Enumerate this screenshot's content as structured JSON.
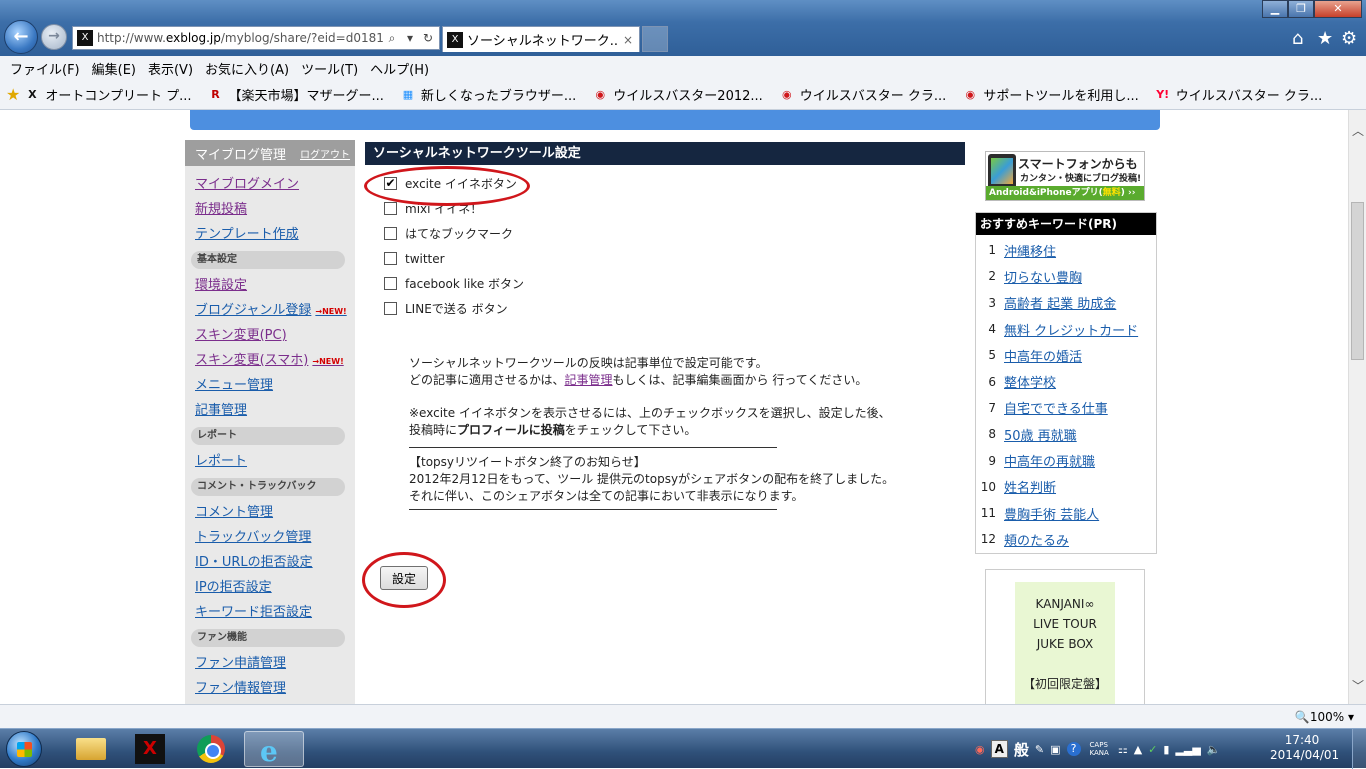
{
  "browser": {
    "address_prefix": "http://www.",
    "address_domain": "exblog.jp",
    "address_rest": "/myblog/share/?eid=d0181",
    "tab_title": "ソーシャルネットワーク...",
    "close_glyph": "×"
  },
  "menu": [
    "ファイル(F)",
    "編集(E)",
    "表示(V)",
    "お気に入り(A)",
    "ツール(T)",
    "ヘルプ(H)"
  ],
  "favorites": [
    {
      "label": "オートコンプリート プ...",
      "icon": "excite-icon",
      "glyph": "X",
      "color": "#111111"
    },
    {
      "label": "【楽天市場】マザーグー...",
      "icon": "rakuten-icon",
      "glyph": "R",
      "color": "#bf0000"
    },
    {
      "label": "新しくなったブラウザー...",
      "icon": "windows-icon",
      "glyph": "▦",
      "color": "#1e90ff"
    },
    {
      "label": "ウイルスバスター2012...",
      "icon": "trendmicro-icon",
      "glyph": "◉",
      "color": "#d0161b"
    },
    {
      "label": "ウイルスバスター クラ...",
      "icon": "trendmicro-icon",
      "glyph": "◉",
      "color": "#d0161b"
    },
    {
      "label": "サポートツールを利用し...",
      "icon": "trendmicro-icon",
      "glyph": "◉",
      "color": "#d0161b"
    },
    {
      "label": "ウイルスバスター クラ...",
      "icon": "yahoo-icon",
      "glyph": "Y!",
      "color": "#ff0033"
    }
  ],
  "leftnav": {
    "header": "マイブログ管理",
    "logout": "ログアウト",
    "group1": [
      {
        "label": "マイブログメイン",
        "visited": true
      },
      {
        "label": "新規投稿",
        "visited": true
      },
      {
        "label": "テンプレート作成",
        "visited": false
      }
    ],
    "section_basic": "基本設定",
    "group2": [
      {
        "label": "環境設定",
        "visited": true,
        "new": false
      },
      {
        "label": "ブログジャンル登録",
        "visited": false,
        "new": true
      },
      {
        "label": "スキン変更(PC)",
        "visited": true,
        "new": false
      },
      {
        "label": "スキン変更(スマホ)",
        "visited": true,
        "new": true
      },
      {
        "label": "メニュー管理",
        "visited": false,
        "new": false
      },
      {
        "label": "記事管理",
        "visited": false,
        "new": false
      }
    ],
    "section_report": "レポート",
    "group3": [
      {
        "label": "レポート",
        "visited": false
      }
    ],
    "section_comment": "コメント・トラックバック",
    "group4": [
      {
        "label": "コメント管理",
        "visited": false
      },
      {
        "label": "トラックバック管理",
        "visited": false
      },
      {
        "label": "ID・URLの拒否設定",
        "visited": false
      },
      {
        "label": "IPの拒否設定",
        "visited": false
      },
      {
        "label": "キーワード拒否設定",
        "visited": false
      }
    ],
    "section_fan": "ファン機能",
    "group5": [
      {
        "label": "ファン申請管理",
        "visited": false
      },
      {
        "label": "ファン情報管理",
        "visited": false
      }
    ],
    "new_badge": "→NEW!"
  },
  "main": {
    "title": "ソーシャルネットワークツール設定",
    "options": [
      {
        "label": "excite イイネボタン",
        "checked": true
      },
      {
        "label": "mixi イイネ！",
        "checked": false
      },
      {
        "label": "はてなブックマーク",
        "checked": false
      },
      {
        "label": "twitter",
        "checked": false
      },
      {
        "label": "facebook like ボタン",
        "checked": false
      },
      {
        "label": "LINEで送る ボタン",
        "checked": false
      }
    ],
    "note1": "ソーシャルネットワークツールの反映は記事単位で設定可能です。",
    "note2_pre": "どの記事に適用させるかは、",
    "note2_link": "記事管理",
    "note2_post": "もしくは、記事編集画面から 行ってください。",
    "note3": "※excite イイネボタンを表示させるには、上のチェックボックスを選択し、設定した後、",
    "note4_pre": "投稿時に",
    "note4_bold": "プロフィールに投稿",
    "note4_post": "をチェックして下さい。",
    "notice_title": "【topsyリツイートボタン終了のお知らせ】",
    "notice1": "2012年2月12日をもって、ツール 提供元のtopsyがシェアボタンの配布を終了しました。",
    "notice2": "それに伴い、このシェアボタンは全ての記事において非表示になります。",
    "save_label": "設定",
    "check_glyph": "✔"
  },
  "right": {
    "promo_line1": "スマートフォンからも",
    "promo_line2": "カンタン・快適にブログ投稿!",
    "promo_bar": "Android&iPhoneアプリ(",
    "promo_free": "無料",
    "promo_bar_end": ") ››",
    "keywords_title": "おすすめキーワード(PR)",
    "keywords": [
      {
        "num": "1",
        "label": "沖縄移住"
      },
      {
        "num": "2",
        "label": "切らない豊胸"
      },
      {
        "num": "3",
        "label": "高齢者 起業 助成金"
      },
      {
        "num": "4",
        "label": "無料 クレジットカード"
      },
      {
        "num": "5",
        "label": "中高年の婚活"
      },
      {
        "num": "6",
        "label": "整体学校"
      },
      {
        "num": "7",
        "label": "自宅でできる仕事"
      },
      {
        "num": "8",
        "label": "50歳 再就職"
      },
      {
        "num": "9",
        "label": "中高年の再就職"
      },
      {
        "num": "10",
        "label": "姓名判断"
      },
      {
        "num": "11",
        "label": "豊胸手術 芸能人"
      },
      {
        "num": "12",
        "label": "頬のたるみ"
      }
    ],
    "ad_lines": [
      "KANJANI∞",
      "LIVE TOUR",
      "JUKE BOX",
      "",
      "【初回限定盤】"
    ]
  },
  "statusbar": {
    "zoom": "🔍100%  ▾"
  },
  "taskbar": {
    "ime_mode": "A",
    "ime_kanji": "般",
    "caps": "CAPS",
    "kana": "KANA",
    "time": "17:40",
    "date": "2014/04/01"
  }
}
